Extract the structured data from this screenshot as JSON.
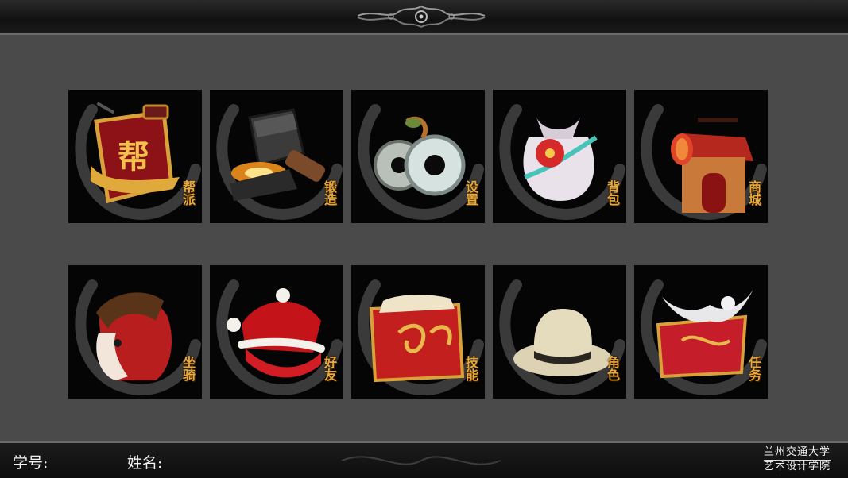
{
  "header": {
    "ornament_icon": "filigree-ornament-icon"
  },
  "icons": [
    {
      "label": "帮派",
      "icon": "guild-banner-icon",
      "accent": "#a3141c"
    },
    {
      "label": "锻造",
      "icon": "forge-hammer-icon",
      "accent": "#ff8a1a"
    },
    {
      "label": "设置",
      "icon": "settings-gears-icon",
      "accent": "#c9d7d4"
    },
    {
      "label": "背包",
      "icon": "backpack-pouch-icon",
      "accent": "#d62a2a"
    },
    {
      "label": "商城",
      "icon": "shop-pavilion-icon",
      "accent": "#c0392b"
    },
    {
      "label": "坐骑",
      "icon": "horse-mount-icon",
      "accent": "#b81e1e"
    },
    {
      "label": "好友",
      "icon": "friends-santa-hat-icon",
      "accent": "#c4141a"
    },
    {
      "label": "技能",
      "icon": "skill-book-icon",
      "accent": "#c31f1f"
    },
    {
      "label": "角色",
      "icon": "character-hat-icon",
      "accent": "#e5dbbd"
    },
    {
      "label": "任务",
      "icon": "quest-scroll-bird-icon",
      "accent": "#c51d2a"
    }
  ],
  "footer": {
    "student_id_label": "学号:",
    "name_label": "姓名:",
    "school_line1": "兰州交通大学",
    "school_line2": "艺术设计学院"
  },
  "colors": {
    "background": "#4a4a4a",
    "tile": "#050505",
    "label": "#e8a93a"
  }
}
